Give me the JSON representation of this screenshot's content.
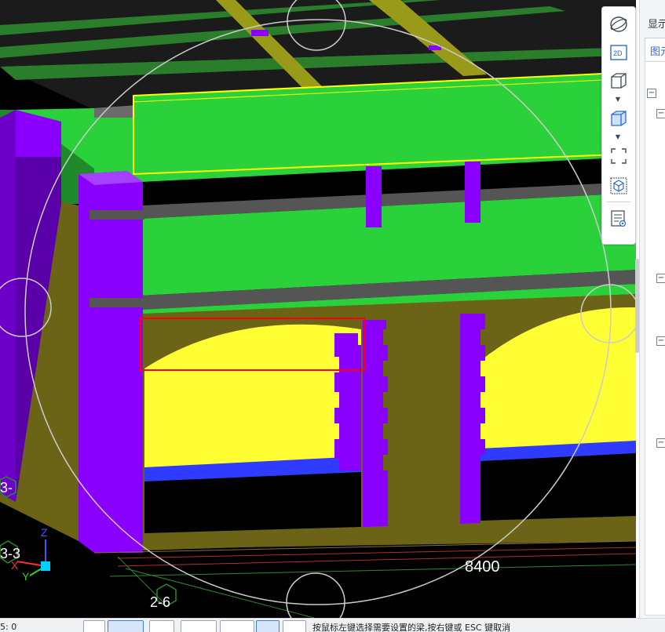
{
  "viewport": {
    "dimension_label": "8400",
    "axis_tags": [
      "3-3",
      "2-6",
      "3-"
    ],
    "axes": {
      "x": "X",
      "y": "Y",
      "z": "Z"
    },
    "colors": {
      "background": "#000000",
      "slab_green": "#2bd13a",
      "column_purple": "#8a00ff",
      "wall_yellow": "#ffff33",
      "earth_olive": "#6b6417",
      "selection_red": "#ff0000",
      "highlight_yellow": "#ffff00",
      "beam_gray": "#555555",
      "strip_blue": "#2f3cff"
    }
  },
  "toolbar": {
    "icons": [
      "orbit-icon",
      "2d-view-icon",
      "3d-box-icon",
      "solid-box-icon",
      "region-select-icon",
      "view-cube-icon",
      "display-settings-icon"
    ],
    "view_2d_label": "2D"
  },
  "panel": {
    "header": "显示",
    "tab_label": "图元",
    "toggle_symbol": "−"
  },
  "statusbar": {
    "coordinate": "5: 0",
    "hint": "按鼠标左键选择需要设置的梁,按右键或 ESC 键取消"
  }
}
